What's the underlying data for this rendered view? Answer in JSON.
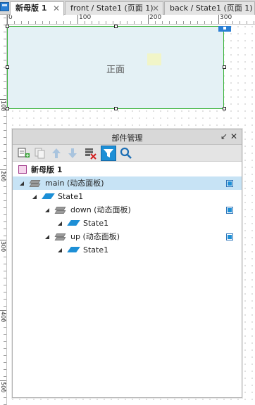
{
  "tabs": [
    {
      "label": "新母版 1",
      "close": "✕",
      "active": true
    },
    {
      "label": "front / State1 (页面 1)",
      "close": "✕",
      "active": false
    },
    {
      "label": "back / State1 (页面 1)",
      "close": "",
      "active": false
    }
  ],
  "ruler": {
    "top_numbers": [
      "0",
      "100",
      "200",
      "300"
    ],
    "left_numbers": [
      "100",
      "200",
      "300",
      "400",
      "500"
    ]
  },
  "canvas": {
    "widget_label": "正面",
    "widget_fill": "#e4f1f5",
    "selection_color": "#3cb43c"
  },
  "outline": {
    "title": "部件管理",
    "header_buttons": {
      "collapse_icon": "arrow-down-left-icon",
      "collapse_glyph": "↙",
      "close_icon": "close-icon",
      "close_glyph": "✕"
    },
    "toolbar": [
      {
        "icon": "add-master-icon"
      },
      {
        "icon": "duplicate-icon"
      },
      {
        "icon": "move-up-icon"
      },
      {
        "icon": "move-down-icon"
      },
      {
        "icon": "delete-icon"
      },
      {
        "icon": "filter-icon"
      },
      {
        "icon": "search-icon"
      }
    ],
    "root": {
      "label": "新母版 1",
      "icon": "master-page-icon"
    },
    "rows": [
      {
        "label": "main (动态面板)",
        "level": 1,
        "type": "dynamic-panel",
        "selected": true,
        "visible_checkbox": true
      },
      {
        "label": "State1",
        "level": 2,
        "type": "state",
        "selected": false,
        "visible_checkbox": false
      },
      {
        "label": "down (动态面板)",
        "level": 3,
        "type": "dynamic-panel",
        "selected": false,
        "visible_checkbox": true
      },
      {
        "label": "State1",
        "level": 4,
        "type": "state",
        "selected": false,
        "visible_checkbox": false
      },
      {
        "label": "up (动态面板)",
        "level": 3,
        "type": "dynamic-panel",
        "selected": false,
        "visible_checkbox": true
      },
      {
        "label": "State1",
        "level": 4,
        "type": "state",
        "selected": false,
        "visible_checkbox": false
      }
    ],
    "accent_color": "#1d8fd6",
    "selected_row_color": "#c7e3f5"
  }
}
